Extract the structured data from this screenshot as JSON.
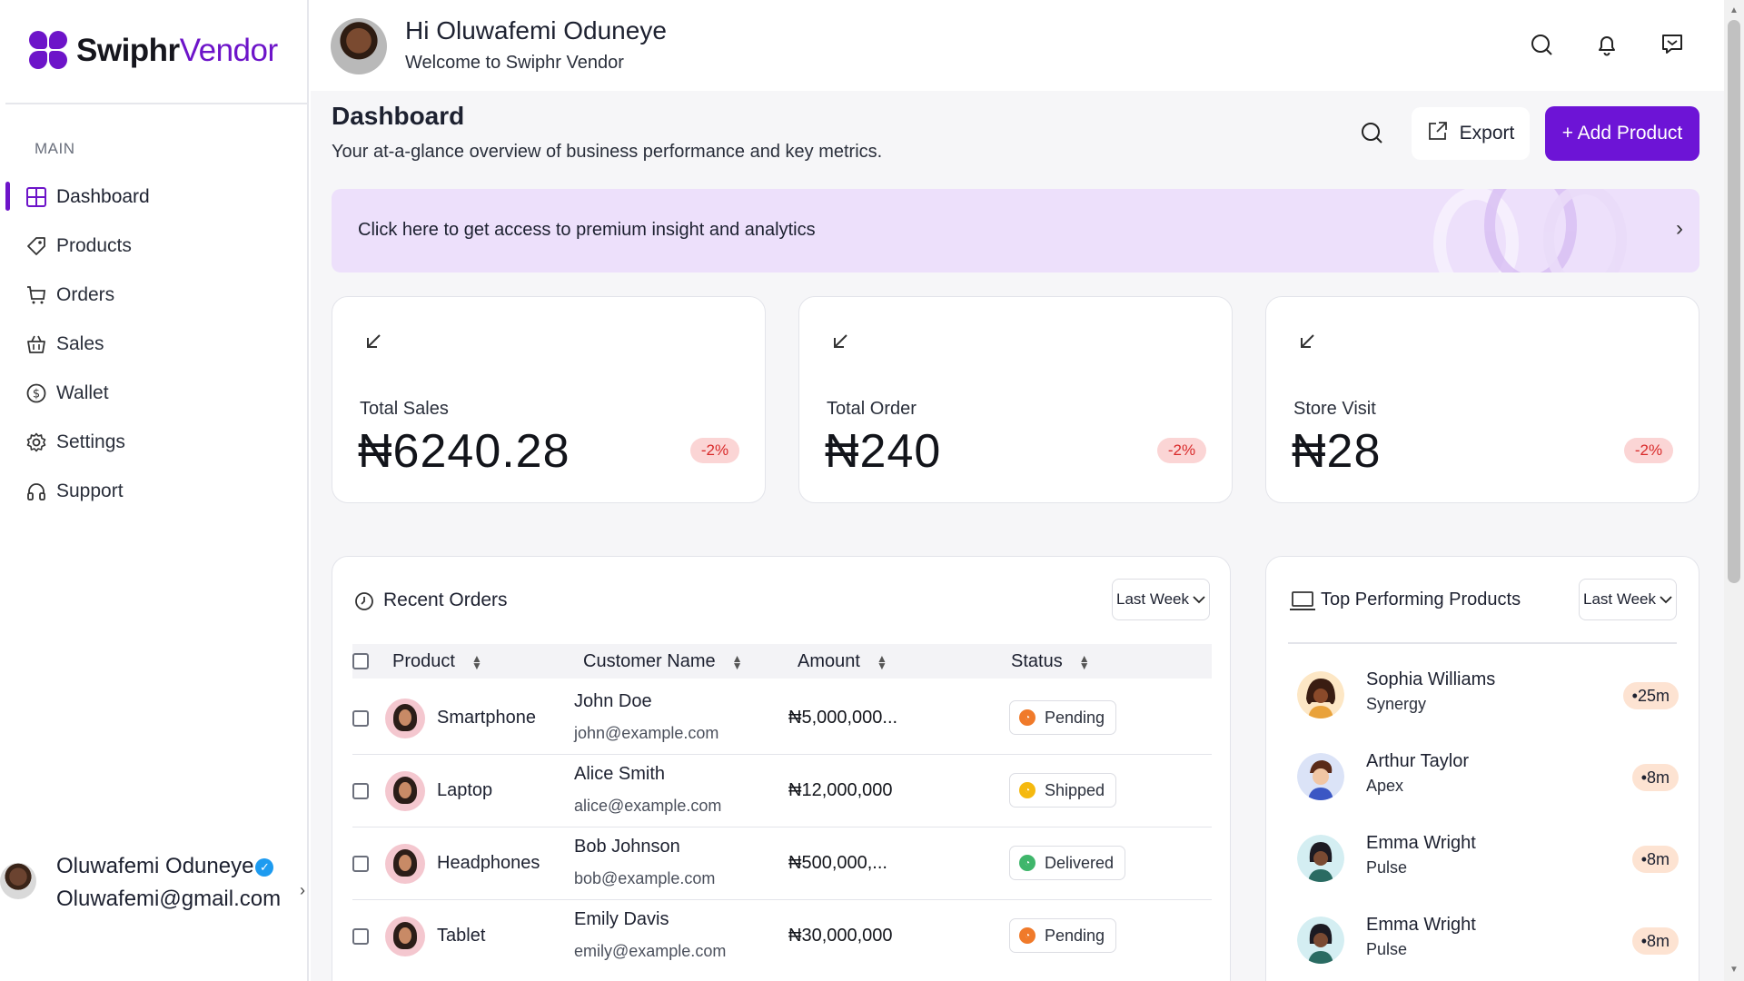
{
  "brand": {
    "name_part1": "Swiphr",
    "name_part2": "Vendor",
    "color": "#6d14c9"
  },
  "sidebar": {
    "section_label": "MAIN",
    "items": [
      {
        "label": "Dashboard",
        "icon": "grid-icon",
        "active": true
      },
      {
        "label": "Products",
        "icon": "tag-icon"
      },
      {
        "label": "Orders",
        "icon": "cart-icon"
      },
      {
        "label": "Sales",
        "icon": "basket-icon"
      },
      {
        "label": "Wallet",
        "icon": "dollar-circle-icon"
      },
      {
        "label": "Settings",
        "icon": "gear-icon"
      },
      {
        "label": "Support",
        "icon": "headphones-icon"
      }
    ],
    "user": {
      "name": "Oluwafemi Oduneye",
      "email": "Oluwafemi@gmail.com"
    }
  },
  "header": {
    "greeting": "Hi Oluwafemi Oduneye",
    "welcome": "Welcome to Swiphr Vendor",
    "icons": [
      "search-icon",
      "bell-icon",
      "message-icon"
    ]
  },
  "page": {
    "title": "Dashboard",
    "subtitle": "Your at-a-glance overview of business performance and key metrics.",
    "export_label": "Export",
    "add_product_label": "+ Add Product",
    "banner_text": "Click here to get access to premium insight and analytics"
  },
  "stats": [
    {
      "label": "Total Sales",
      "value": "₦6240.28",
      "change": "-2%"
    },
    {
      "label": "Total Order",
      "value": "₦240",
      "change": "-2%"
    },
    {
      "label": "Store Visit",
      "value": "₦28",
      "change": "-2%"
    }
  ],
  "recent_orders": {
    "title": "Recent Orders",
    "filter": "Last Week",
    "columns": [
      "Product",
      "Customer Name",
      "Amount",
      "Status"
    ],
    "rows": [
      {
        "product": "Smartphone",
        "customer": "John Doe",
        "email": "john@example.com",
        "amount": "₦5,000,000...",
        "status": "Pending",
        "status_color": "#f07a2a"
      },
      {
        "product": "Laptop",
        "customer": "Alice Smith",
        "email": "alice@example.com",
        "amount": "₦12,000,000",
        "status": "Shipped",
        "status_color": "#f5b90f"
      },
      {
        "product": "Headphones",
        "customer": "Bob Johnson",
        "email": "bob@example.com",
        "amount": "₦500,000,...",
        "status": "Delivered",
        "status_color": "#3fb66b"
      },
      {
        "product": "Tablet",
        "customer": "Emily Davis",
        "email": "emily@example.com",
        "amount": "₦30,000,000",
        "status": "Pending",
        "status_color": "#f07a2a"
      }
    ]
  },
  "top_products": {
    "title": "Top Performing Products",
    "filter": "Last Week",
    "items": [
      {
        "name": "Sophia Williams",
        "sub": "Synergy",
        "time": "•25m"
      },
      {
        "name": "Arthur Taylor",
        "sub": "Apex",
        "time": "•8m"
      },
      {
        "name": "Emma Wright",
        "sub": "Pulse",
        "time": "•8m"
      },
      {
        "name": "Emma Wright",
        "sub": "Pulse",
        "time": "•8m"
      }
    ]
  }
}
